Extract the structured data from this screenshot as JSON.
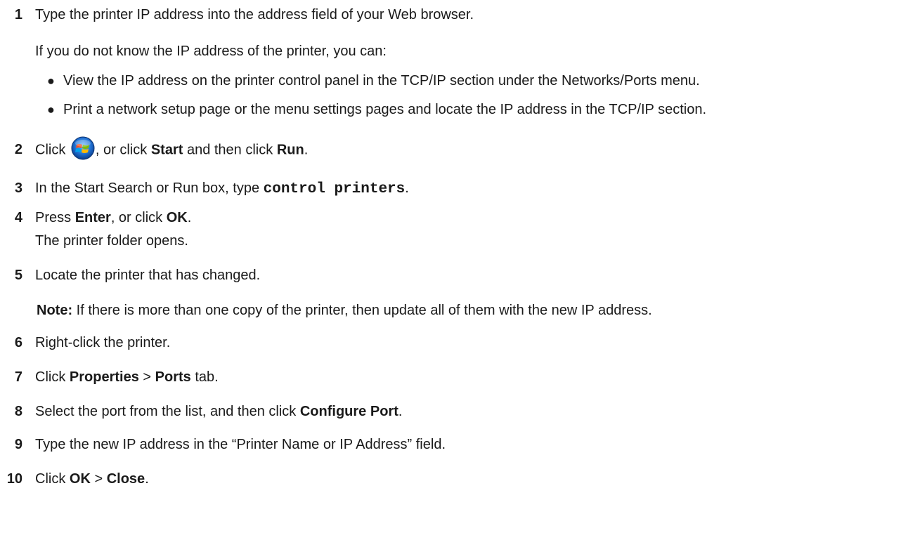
{
  "steps": [
    {
      "n": "1",
      "text": "Type the printer IP address into the address field of your Web browser."
    },
    {
      "sub": "If you do not know the IP address of the printer, you can:",
      "bullets": [
        "View the IP address on the printer control panel in the TCP/IP section under the Networks/Ports menu.",
        "Print a network setup page or the menu settings pages and locate the IP address in the TCP/IP section."
      ]
    },
    {
      "n": "2",
      "a": "Click",
      "b": ", or click",
      "c": "Start",
      "d": "and then click",
      "e": "Run",
      "f": "."
    },
    {
      "n": "3",
      "a": "In the Start Search or Run box, type",
      "code": "control printers",
      "f": "."
    },
    {
      "n": "4",
      "a": "Press",
      "b": "Enter",
      "c": ", or click",
      "d": "OK",
      "f": ".",
      "sub": "The printer folder opens."
    },
    {
      "n": "5",
      "text": "Locate the printer that has changed.",
      "note_label": "Note:",
      "note": "If there is more than one copy of the printer, then update all of them with the new IP address."
    },
    {
      "n": "6",
      "text": "Right-click the printer."
    },
    {
      "n": "7",
      "a": "Click",
      "b": "Properties",
      "c": ">",
      "d": "Ports",
      "e": "tab."
    },
    {
      "n": "8",
      "a": "Select the port from the list, and then click",
      "b": "Configure Port",
      "f": "."
    },
    {
      "n": "9",
      "text": "Type the new IP address in the “Printer Name or IP Address” field."
    },
    {
      "n": "10",
      "a": "Click",
      "b": "OK",
      "c": ">",
      "d": "Close",
      "f": "."
    }
  ],
  "icons": {
    "start_button": "windows-start-orb-icon"
  }
}
